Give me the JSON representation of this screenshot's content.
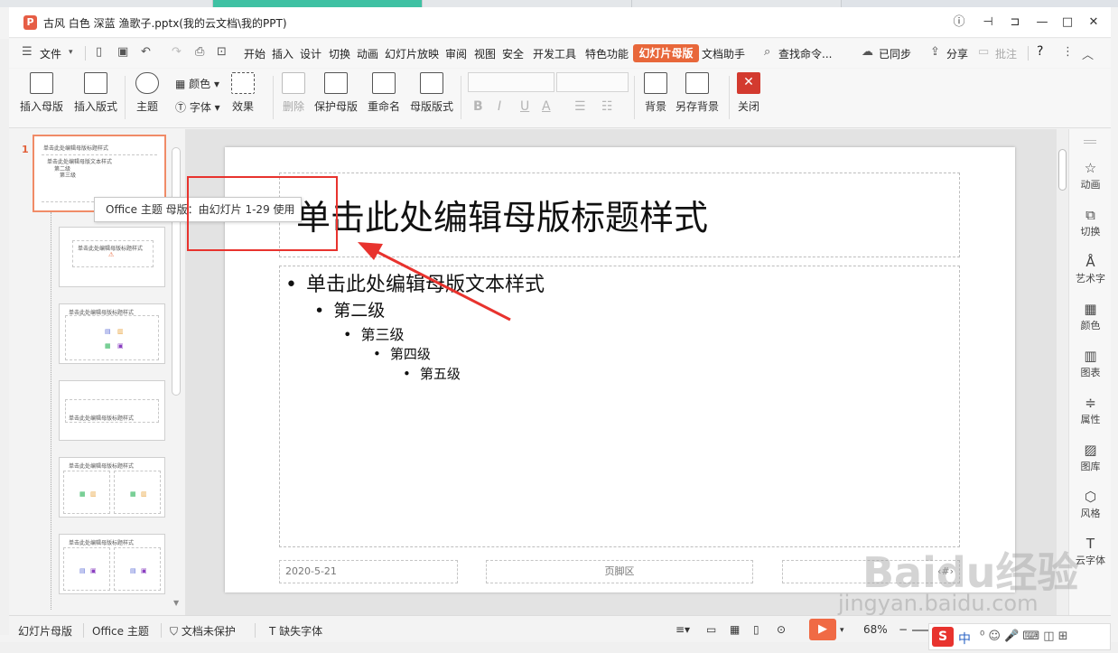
{
  "window": {
    "doc_title": "古风 白色 深蓝 渔歌子.pptx(我的云文档\\我的PPT)",
    "app_logo_letter": "P"
  },
  "menu": {
    "file_label": "文件",
    "items": [
      "开始",
      "插入",
      "设计",
      "切换",
      "动画",
      "幻灯片放映",
      "审阅",
      "视图",
      "安全",
      "开发工具",
      "特色功能"
    ],
    "active_tab": "幻灯片母版",
    "doc_assistant": "文档助手",
    "search_label": "查找命令...",
    "synced_label": "已同步",
    "share_label": "分享",
    "comment_label": "批注",
    "help_label": "?"
  },
  "ribbon": {
    "insert_master": "插入母版",
    "insert_layout": "插入版式",
    "theme": "主题",
    "colors": "颜色",
    "fonts": "字体",
    "effects": "效果",
    "delete": "删除",
    "protect_master": "保护母版",
    "rename": "重命名",
    "master_layout": "母版版式",
    "fmt_bold": "B",
    "fmt_italic": "I",
    "fmt_underline": "U",
    "fmt_fontcolor": "A",
    "background": "背景",
    "save_background": "另存背景",
    "close": "关闭"
  },
  "thumbnails": {
    "first_number": "1",
    "master_title": "单击此处编辑母版标题样式",
    "master_body": "单击此处编辑母版文本样式",
    "level2": "第二级",
    "level3": "第三级"
  },
  "tooltip": {
    "text": "Office 主题 母版：由幻灯片 1-29 使用"
  },
  "slide": {
    "title": "单击此处编辑母版标题样式",
    "levels": [
      "单击此处编辑母版文本样式",
      "第二级",
      "第三级",
      "第四级",
      "第五级"
    ],
    "date": "2020-5-21",
    "footer": "页脚区",
    "page_number_mark": "‹#›"
  },
  "right_panel": {
    "items": [
      "动画",
      "切换",
      "艺术字",
      "颜色",
      "图表",
      "属性",
      "图库",
      "风格",
      "云字体"
    ]
  },
  "statusbar": {
    "mode": "幻灯片母版",
    "theme": "Office 主题",
    "protection": "文档未保护",
    "missing_fonts": "缺失字体",
    "zoom": "68%"
  },
  "watermark": {
    "logo": "Baidu经验",
    "url": "jingyan.baidu.com"
  },
  "ime": {
    "logo": "S",
    "text": "中"
  },
  "colors": {
    "accent": "#e8673a",
    "annotation": "#e8332e"
  }
}
